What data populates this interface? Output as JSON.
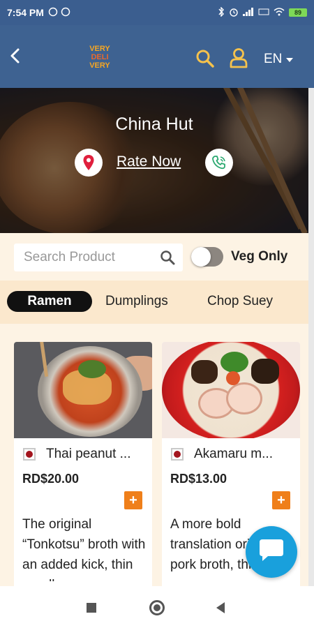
{
  "status_bar": {
    "time": "7:54 PM",
    "left_icons": [
      "whatsapp-icon",
      "whatsapp-icon"
    ],
    "right_icons": [
      "bluetooth-icon",
      "alarm-icon",
      "signal-icon",
      "volte-icon",
      "wifi-icon"
    ],
    "battery": "89"
  },
  "app_bar": {
    "logo_lines": [
      "VERY",
      "DELI",
      "VERY"
    ],
    "language": "EN",
    "icons": [
      "back-arrow-icon",
      "search-icon",
      "user-icon",
      "caret-down-icon"
    ]
  },
  "restaurant": {
    "name": "China Hut",
    "rate_label": "Rate Now",
    "icons": [
      "location-pin-icon",
      "phone-icon"
    ]
  },
  "search": {
    "placeholder": "Search Product",
    "value": ""
  },
  "veg_toggle": {
    "label": "Veg Only",
    "on": false
  },
  "categories": [
    {
      "label": "Ramen",
      "active": true
    },
    {
      "label": "Dumplings",
      "active": false
    },
    {
      "label": "Chop Suey",
      "active": false
    }
  ],
  "products": [
    {
      "name": "Thai peanut ...",
      "price": "RD$20.00",
      "add_label": "+",
      "description": "The original “Tonkotsu” broth with an added kick, thin noodl",
      "veg_marker_color": "#a3151e"
    },
    {
      "name": "Akamaru m...",
      "price": "RD$13.00",
      "add_label": "+",
      "description": "A more bold translation original pork broth, thin noo",
      "veg_marker_color": "#a3151e"
    }
  ],
  "colors": {
    "status_bar": "#3b5e8f",
    "app_bar": "#3e6291",
    "page_bg": "#fdf3e4",
    "category_bar": "#fbe8cd",
    "accent_add": "#ef7f1a",
    "chat_button": "#19a0dc",
    "active_category": "#111111"
  },
  "nav_bar": {
    "icons": [
      "recents-square-icon",
      "home-circle-icon",
      "back-triangle-icon"
    ]
  }
}
